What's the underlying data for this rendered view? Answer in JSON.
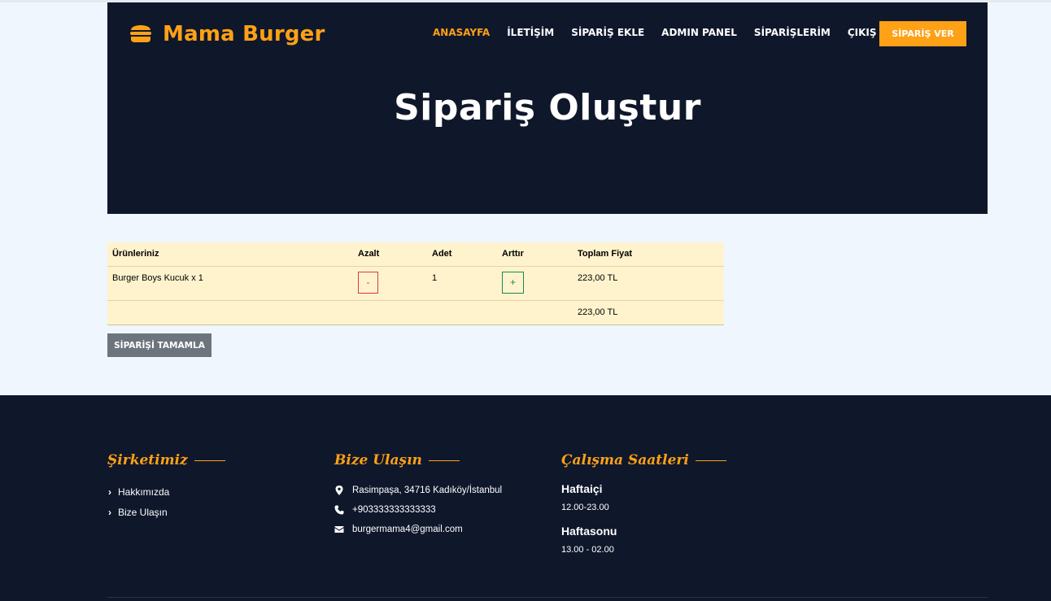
{
  "brand": {
    "name": "Mama Burger",
    "icon": "burger-icon",
    "accent": "#fea116"
  },
  "nav": {
    "items": [
      {
        "label": "ANASAYFA",
        "active": true
      },
      {
        "label": "İLETİŞİM",
        "active": false
      },
      {
        "label": "SİPARİŞ EKLE",
        "active": false
      },
      {
        "label": "ADMIN PANEL",
        "active": false
      },
      {
        "label": "SİPARİŞLERİM",
        "active": false
      },
      {
        "label": "ÇIKIŞ YAP",
        "active": false
      }
    ],
    "order_button": "SİPARİŞ VER"
  },
  "hero": {
    "title": "Sipariş Oluştur",
    "background": "#0f172b"
  },
  "cart": {
    "headers": [
      "Ürünleriniz",
      "Azalt",
      "Adet",
      "Arttır",
      "Toplam Fiyat"
    ],
    "rows": [
      {
        "product": "Burger Boys Kucuk x 1",
        "decrease": "-",
        "quantity": "1",
        "increase": "+",
        "total": "223,00 TL"
      }
    ],
    "grand_total": "223,00 TL",
    "complete_button": "SİPARİŞİ TAMAMLA"
  },
  "footer": {
    "company": {
      "title": "Şirketimiz",
      "links": [
        "Hakkımızda",
        "Bize Ulaşın"
      ]
    },
    "contact": {
      "title": "Bize Ulaşın",
      "address": "Rasimpaşa, 34716 Kadıköy/İstanbul",
      "phone": "+903333333333333",
      "email": "burgermama4@gmail.com"
    },
    "hours": {
      "title": "Çalışma Saatleri",
      "weekday_label": "Haftaiçi",
      "weekday_hours": "12.00-23.00",
      "weekend_label": "Haftasonu",
      "weekend_hours": "13.00 - 02.00"
    }
  }
}
